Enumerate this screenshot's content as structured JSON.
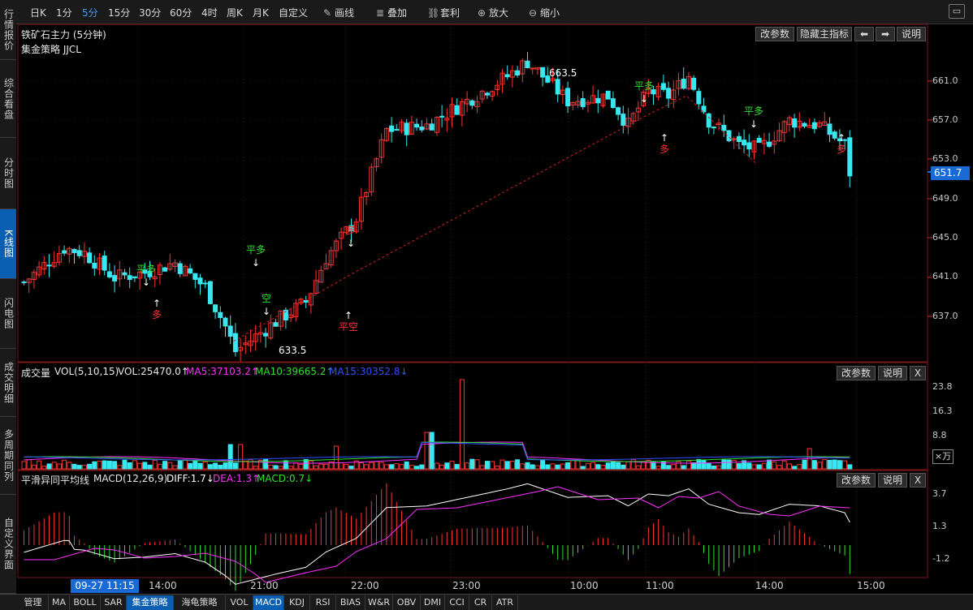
{
  "left_tabs": [
    "行情报价",
    "综合看盘",
    "分时图",
    "K线图",
    "闪电图",
    "成交明细",
    "多周期同列",
    "自定义界面"
  ],
  "toolbar": {
    "periods": [
      "日K",
      "1分",
      "5分",
      "15分",
      "30分",
      "60分",
      "4时",
      "周K",
      "月K",
      "自定义"
    ],
    "selected_period": "5分",
    "tools": [
      {
        "label": "画线",
        "icon": "pencil-icon"
      },
      {
        "label": "叠加",
        "icon": "layers-icon"
      },
      {
        "label": "套利",
        "icon": "arbitrage-icon"
      },
      {
        "label": "放大",
        "icon": "zoom-in-icon"
      },
      {
        "label": "缩小",
        "icon": "zoom-out-icon"
      }
    ]
  },
  "main": {
    "title": "铁矿石主力 (5分钟)",
    "strategy": "集金策略 JJCL",
    "buttons": {
      "params": "改参数",
      "hide": "隐藏主指标",
      "prev": "⬅",
      "next": "➡",
      "help": "说明"
    },
    "y_labels": [
      "661.0",
      "657.0",
      "653.0",
      "649.0",
      "645.0",
      "641.0",
      "637.0"
    ],
    "current_price": "651.7",
    "high_label": "663.5",
    "low_label": "633.5",
    "signals": [
      {
        "text": "平多",
        "color": "#30e030"
      },
      {
        "text": "多",
        "color": "#ff3030"
      },
      {
        "text": "平多",
        "color": "#30e030"
      },
      {
        "text": "空",
        "color": "#30e030"
      },
      {
        "text": "多",
        "color": "#ff3030"
      },
      {
        "text": "平空",
        "color": "#ff3030"
      },
      {
        "text": "平多",
        "color": "#30e030"
      },
      {
        "text": "多",
        "color": "#ff3030"
      },
      {
        "text": "平多",
        "color": "#30e030"
      },
      {
        "text": "多",
        "color": "#ff3030"
      }
    ]
  },
  "volume": {
    "title": "成交量",
    "params_text": "VOL(5,10,15)",
    "vol": "VOL:25470.0↑",
    "ma5": "MA5:37103.2↑",
    "ma10": "MA10:39665.2↑",
    "ma15": "MA15:30352.8↓",
    "colors": {
      "ma5": "#ff30ff",
      "ma10": "#30e030",
      "ma15": "#3050ff"
    },
    "buttons": {
      "params": "改参数",
      "help": "说明",
      "close": "X"
    },
    "y_labels": [
      "23.8",
      "16.3",
      "8.8"
    ],
    "unit": "×万"
  },
  "macd": {
    "title": "平滑异同平均线",
    "params_text": "MACD(12,26,9)",
    "diff": "DIFF:1.7↓",
    "dea": "DEA:1.3↑",
    "macd": "MACD:0.7↓",
    "colors": {
      "diff": "#ffffff",
      "dea": "#ff30ff",
      "macd": "#30e030"
    },
    "buttons": {
      "params": "改参数",
      "help": "说明",
      "close": "X"
    },
    "y_labels": [
      "3.7",
      "1.3",
      "-1.2"
    ]
  },
  "x_axis": {
    "cursor_time": "09-27 11:15",
    "labels": [
      "14:00",
      "21:00",
      "22:00",
      "23:00",
      "10:00",
      "11:00",
      "14:00",
      "15:00"
    ]
  },
  "bottom_tabs": [
    "管理",
    "MA",
    "BOLL",
    "SAR",
    "集金策略",
    "海龟策略",
    "VOL",
    "MACD",
    "KDJ",
    "RSI",
    "BIAS",
    "W&R",
    "OBV",
    "DMI",
    "CCI",
    "CR",
    "ATR"
  ],
  "selected_bottom_tabs": [
    "集金策略",
    "MACD"
  ]
}
